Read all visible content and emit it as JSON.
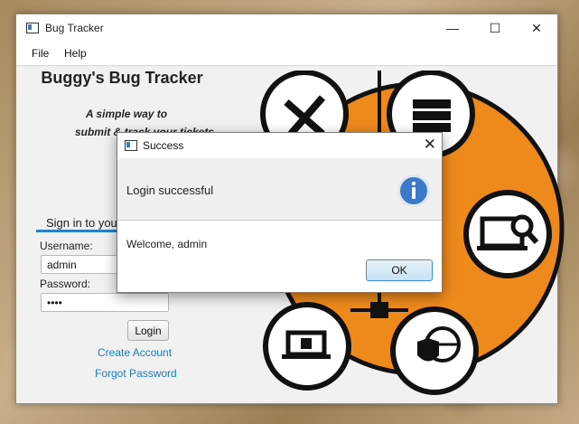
{
  "window": {
    "title": "Bug Tracker",
    "controls": {
      "minimize": "—",
      "maximize": "☐",
      "close": "✕"
    }
  },
  "menu": [
    "File",
    "Help"
  ],
  "app": {
    "heading": "Buggy's Bug Tracker",
    "tagline_line1": "A simple way to",
    "tagline_line2": "submit & track your tickets"
  },
  "login": {
    "tab_label": "Sign in to your account",
    "username_label": "Username:",
    "username_value": "admin",
    "password_label": "Password:",
    "password_value": "••••",
    "login_button": "Login",
    "create_account": "Create Account",
    "forgot_password": "Forgot Password"
  },
  "dialog": {
    "title": "Success",
    "header": "Login successful",
    "content": "Welcome, admin",
    "ok_button": "OK",
    "icon": "info-icon"
  },
  "colors": {
    "accent": "#2d7fc1",
    "link": "#1a7bbf",
    "graphic_orange": "#ee8a1c",
    "info_blue": "#3c78c8"
  },
  "icons": [
    "tools-icon",
    "server-icon",
    "laptop-search-icon",
    "laptop-chip-icon",
    "globe-shield-icon",
    "network-icon"
  ]
}
